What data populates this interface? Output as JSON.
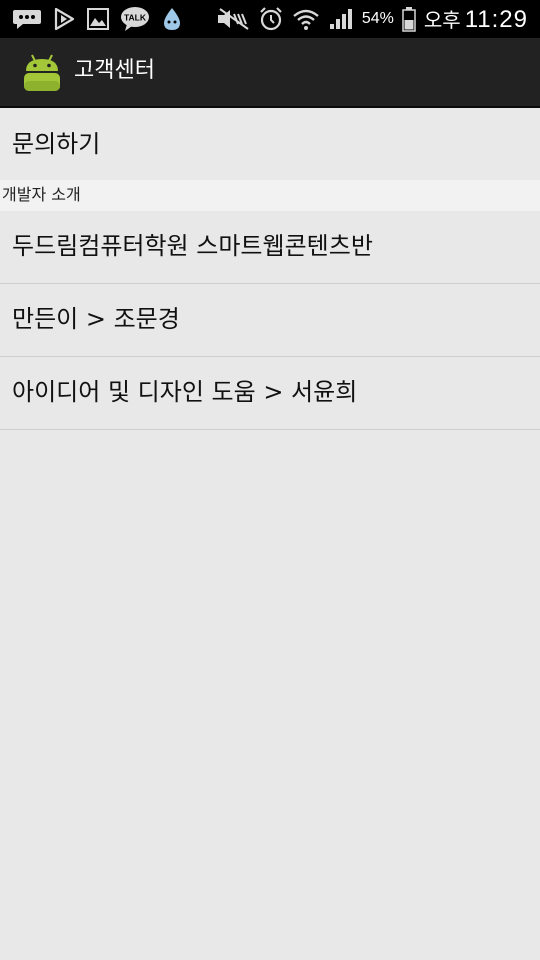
{
  "status_bar": {
    "icons": [
      "message-icon",
      "play-store-icon",
      "gallery-icon",
      "kakaotalk-icon",
      "water-drop-icon",
      "mute-icon",
      "alarm-icon",
      "wifi-icon",
      "signal-icon",
      "battery-icon"
    ],
    "kakao_label": "TALK",
    "battery_percent": "54%",
    "ampm": "오후",
    "time": "11:29"
  },
  "action_bar": {
    "title": "고객센터",
    "icon": "android-app-icon",
    "icon_color": "#a4c639"
  },
  "list": {
    "inquiry_label": "문의하기",
    "section_header": "개발자 소개",
    "items": [
      "두드림컴퓨터학원 스마트웹콘텐츠반",
      "만든이 > 조문경",
      "아이디어 및 디자인 도움 > 서윤희"
    ]
  }
}
